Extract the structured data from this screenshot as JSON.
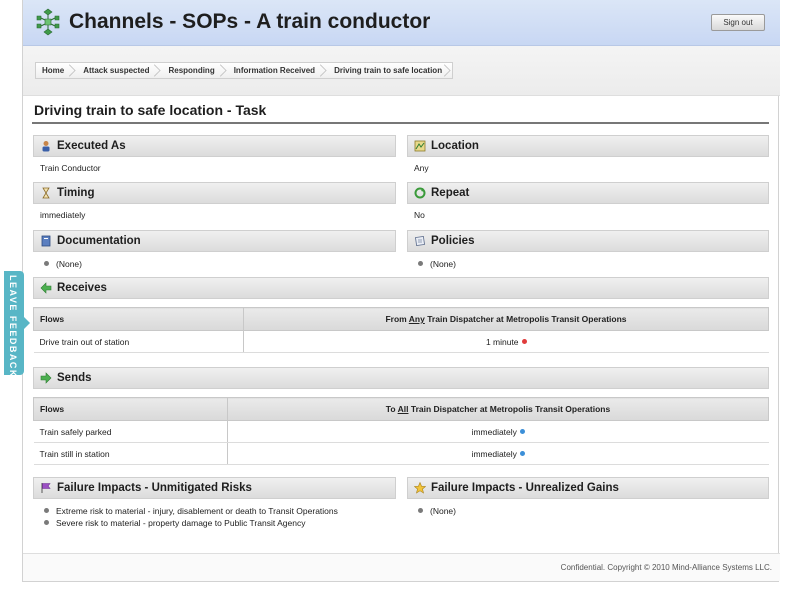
{
  "header": {
    "title": "Channels - SOPs - A train conductor",
    "logo_icon": "snowflake-logo-icon",
    "signout_label": "Sign out"
  },
  "breadcrumbs": [
    "Home",
    "Attack suspected",
    "Responding",
    "Information Received",
    "Driving train to safe location"
  ],
  "task_title": "Driving train to safe location - Task",
  "sections": {
    "executed_as": {
      "label": "Executed As",
      "value": "Train Conductor",
      "icon": "person-icon"
    },
    "location": {
      "label": "Location",
      "value": "Any",
      "icon": "map-icon"
    },
    "timing": {
      "label": "Timing",
      "value": "immediately",
      "icon": "hourglass-icon"
    },
    "repeat": {
      "label": "Repeat",
      "value": "No",
      "icon": "repeat-icon"
    },
    "documentation": {
      "label": "Documentation",
      "value": "(None)",
      "icon": "book-icon"
    },
    "policies": {
      "label": "Policies",
      "value": "(None)",
      "icon": "scroll-icon"
    }
  },
  "receives": {
    "label": "Receives",
    "icon": "arrow-left-icon",
    "col_flows": "Flows",
    "col_source_prefix": "From",
    "col_source_qualifier": "Any",
    "col_source_rest": "Train Dispatcher at Metropolis Transit Operations",
    "rows": [
      {
        "flow": "Drive train out of station",
        "timing": "1 minute",
        "dot_color": "#e03b3b"
      }
    ]
  },
  "sends": {
    "label": "Sends",
    "icon": "arrow-right-icon",
    "col_flows": "Flows",
    "col_target_prefix": "To",
    "col_target_qualifier": "All",
    "col_target_rest": "Train Dispatcher at Metropolis Transit Operations",
    "rows": [
      {
        "flow": "Train safely parked",
        "timing": "immediately",
        "dot_color": "#3b8fd8"
      },
      {
        "flow": "Train still in station",
        "timing": "immediately",
        "dot_color": "#3b8fd8"
      }
    ]
  },
  "failure_risks": {
    "label": "Failure Impacts - Unmitigated Risks",
    "icon": "flag-icon",
    "items": [
      "Extreme risk to material - injury, disablement or death to Transit Operations",
      "Severe risk to material - property damage to Public Transit Agency"
    ]
  },
  "failure_gains": {
    "label": "Failure Impacts - Unrealized Gains",
    "icon": "star-icon",
    "items": [
      "(None)"
    ]
  },
  "footer": {
    "copyright": "Confidential. Copyright © 2010 Mind-Alliance Systems LLC."
  },
  "feedback_tab": {
    "label": "LEAVE FEEDBACK"
  },
  "colors": {
    "header_bg": "#c8d7f3",
    "feedback": "#58b6c6",
    "receive_dot": "#e03b3b",
    "send_dot": "#3b8fd8"
  }
}
